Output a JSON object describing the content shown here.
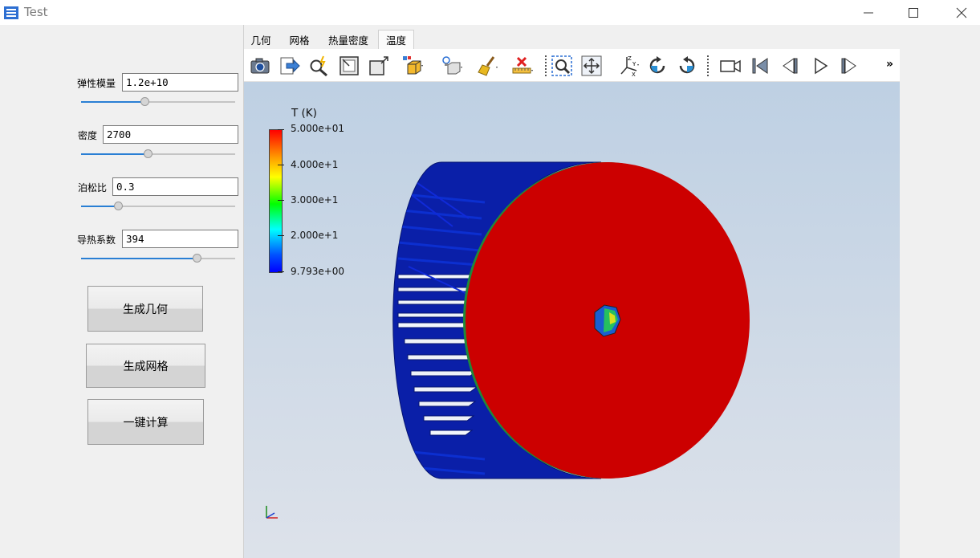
{
  "window": {
    "title": "Test"
  },
  "params": [
    {
      "label": "弹性模量",
      "value": "1.2e+10",
      "slider": 0.41
    },
    {
      "label": "密度",
      "value": "2700",
      "slider": 0.43
    },
    {
      "label": "泊松比",
      "value": "0.3",
      "slider": 0.24
    },
    {
      "label": "导热系数",
      "value": "394",
      "slider": 0.75
    }
  ],
  "buttons": {
    "geometry": "生成几何",
    "mesh": "生成网格",
    "compute": "一键计算"
  },
  "tabs": [
    {
      "label": "几何",
      "active": false
    },
    {
      "label": "网格",
      "active": false
    },
    {
      "label": "热量密度",
      "active": false
    },
    {
      "label": "温度",
      "active": true
    }
  ],
  "toolbar_icons": [
    "camera-icon",
    "export-icon",
    "magnify-spark-icon",
    "reset-view-icon",
    "zoom-box-icon",
    "representation-icon",
    "light-icon",
    "clear-icon",
    "ruler-icon",
    "zoom-to-box-icon",
    "fit-view-icon",
    "axes-icon",
    "rotate-cw-icon",
    "rotate-ccw-icon",
    "record-icon",
    "first-frame-icon",
    "previous-frame-icon",
    "play-icon",
    "last-frame-icon"
  ],
  "toolbar_more": "»",
  "colorbar": {
    "title": "T (K)",
    "labels": [
      "5.000e+01",
      "4.000e+1",
      "3.000e+1",
      "2.000e+1",
      "9.793e+00"
    ],
    "colors": {
      "high": "#ff0000",
      "low": "#0000ff"
    }
  },
  "model": {
    "face_color": "#cc0000",
    "fin_color": "#0a1fa8"
  }
}
